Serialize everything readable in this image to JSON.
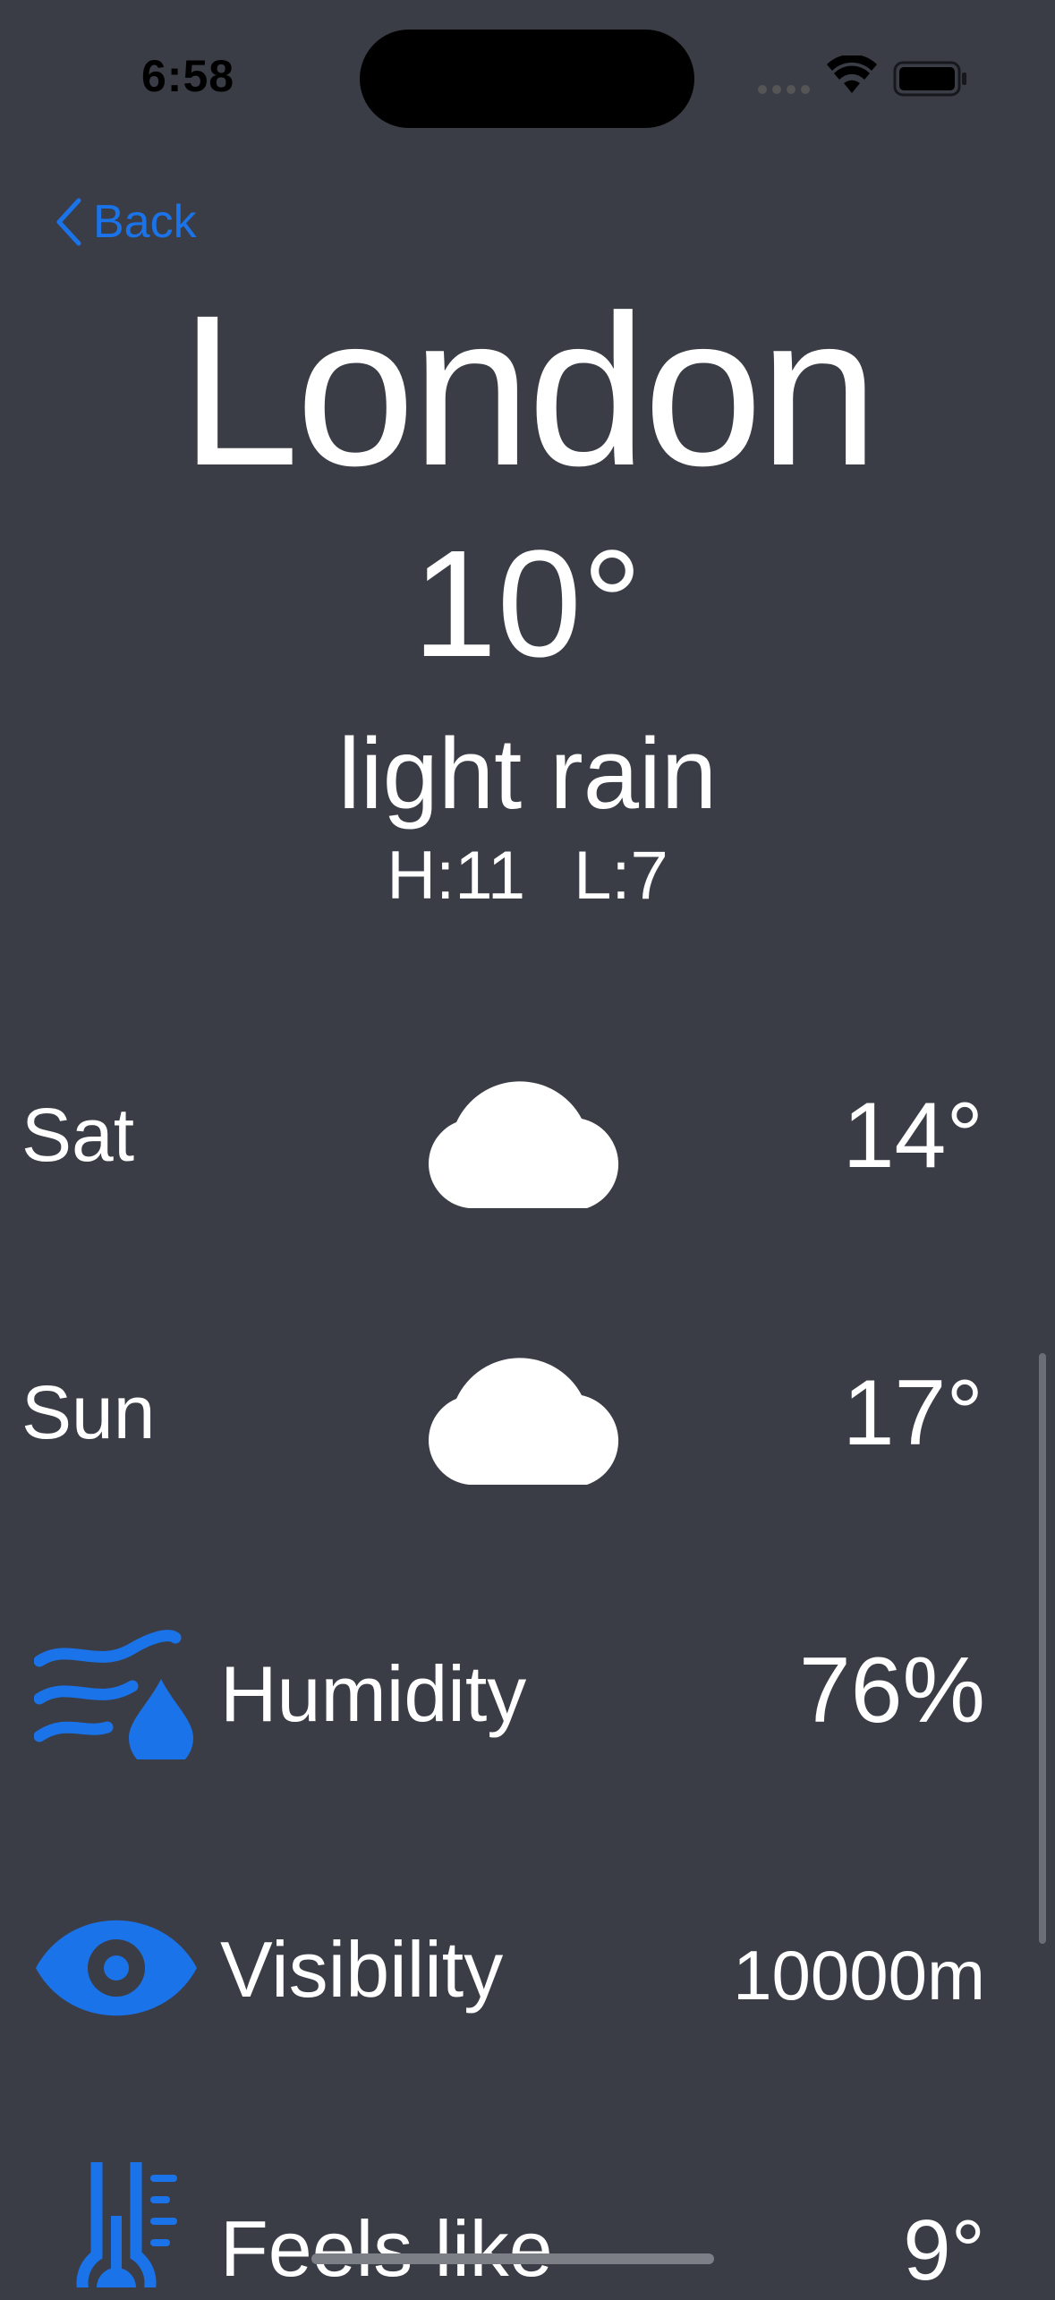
{
  "status_bar": {
    "time": "6:58",
    "icons": [
      "signal-dots-icon",
      "wifi-icon",
      "battery-icon"
    ]
  },
  "nav": {
    "back_label": "Back"
  },
  "current": {
    "city": "London",
    "temperature": "10°",
    "description": "light rain",
    "high": "H:11",
    "low": "L:7"
  },
  "forecast": [
    {
      "day": "Sat",
      "icon": "cloud-icon",
      "temp": "14°"
    },
    {
      "day": "Sun",
      "icon": "cloud-icon",
      "temp": "17°"
    }
  ],
  "metrics": [
    {
      "icon": "humidity-icon",
      "label": "Humidity",
      "value": "76%"
    },
    {
      "icon": "eye-icon",
      "label": "Visibility",
      "value": "10000m"
    },
    {
      "icon": "thermometer-icon",
      "label": "Feels like",
      "value": "9°"
    }
  ],
  "colors": {
    "background": "#3a3d46",
    "accent": "#1a73e8",
    "text": "#ffffff"
  }
}
